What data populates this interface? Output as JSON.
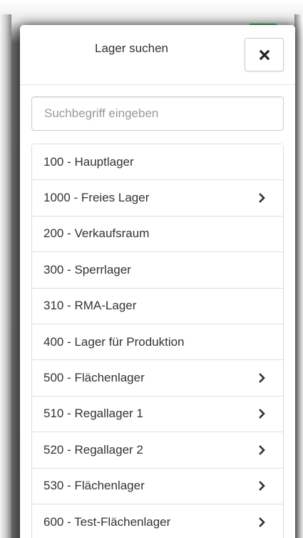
{
  "modal": {
    "title": "Lager suchen",
    "close_icon": "times-icon"
  },
  "search": {
    "placeholder": "Suchbegriff eingeben",
    "value": ""
  },
  "warehouses": [
    {
      "label": "100 - Hauptlager",
      "has_children": false
    },
    {
      "label": "1000 - Freies Lager",
      "has_children": true
    },
    {
      "label": "200 - Verkaufsraum",
      "has_children": false
    },
    {
      "label": "300 - Sperrlager",
      "has_children": false
    },
    {
      "label": "310 - RMA-Lager",
      "has_children": false
    },
    {
      "label": "400 - Lager für Produktion",
      "has_children": false
    },
    {
      "label": "500 - Flächenlager",
      "has_children": true
    },
    {
      "label": "510 - Regallager 1",
      "has_children": true
    },
    {
      "label": "520 - Regallager 2",
      "has_children": true
    },
    {
      "label": "530 - Flächenlager",
      "has_children": true
    },
    {
      "label": "600 - Test-Flächenlager",
      "has_children": true
    }
  ],
  "colors": {
    "accent_green": "#3fae49",
    "text": "#333333",
    "border": "#dddddd"
  }
}
